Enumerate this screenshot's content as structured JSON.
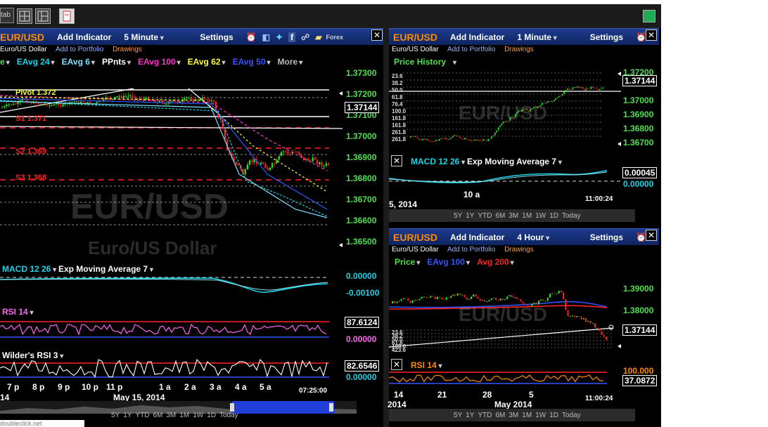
{
  "toolbar": {
    "tab_label": "tab"
  },
  "left": {
    "symbol": "EUR/USD",
    "add_indicator": "Add Indicator",
    "interval": "5 Minute",
    "settings": "Settings",
    "forex_label": "Forex",
    "name": "Euro/US Dollar",
    "add_portfolio": "Add to Portfolio",
    "drawings": "Drawings",
    "indicators": [
      {
        "label": "e",
        "color": "#4fe04f"
      },
      {
        "label": "EAvg 24",
        "color": "#19d4e8"
      },
      {
        "label": "EAvg 6",
        "color": "#7fe0ff"
      },
      {
        "label": "PPnts",
        "color": "#ffffff"
      },
      {
        "label": "EAvg 100",
        "color": "#ff33cc"
      },
      {
        "label": "EAvg 62",
        "color": "#ffff33"
      },
      {
        "label": "EAvg 50",
        "color": "#3355ff"
      },
      {
        "label": "More",
        "color": "#bbbbbb"
      }
    ],
    "pivots": [
      {
        "label": "Pivot 1.372",
        "color": "#ffff33"
      },
      {
        "label": "S1 1.371",
        "color": "#ff2222"
      },
      {
        "label": "S2 1.369",
        "color": "#ff2222"
      },
      {
        "label": "S3 1.368",
        "color": "#ff2222"
      }
    ],
    "price_axis": [
      "1.37300",
      "1.37200",
      "1.37100",
      "1.37000",
      "1.36900",
      "1.36800",
      "1.36700",
      "1.36600",
      "1.36500"
    ],
    "current_price": "1.37144",
    "watermark_symbol": "EUR/USD",
    "watermark_name": "Euro/US Dollar",
    "macd_label": "MACD 12 26",
    "macd_ema_label": "Exp Moving Average 7",
    "macd_axis": [
      "0.00000",
      "-0.00100"
    ],
    "rsi_label": "RSI 14",
    "rsi_value": "87.6124",
    "rsi_axis": "0.00000",
    "wilder_label": "Wilder's RSI 3",
    "wilder_value": "82.6546",
    "wilder_axis": "0.00000",
    "time_labels": [
      "7 p",
      "8 p",
      "9 p",
      "10 p",
      "11 p",
      "1 a",
      "2 a",
      "3 a",
      "4 a",
      "5 a"
    ],
    "date_label": "May 15, 2014",
    "date_prefix": "14",
    "clock": "07:25:00",
    "ranges": [
      "5Y",
      "1Y",
      "YTD",
      "6M",
      "3M",
      "1M",
      "1W",
      "1D",
      "Today"
    ]
  },
  "right_top": {
    "symbol": "EUR/USD",
    "add_indicator": "Add Indicator",
    "interval": "1 Minute",
    "settings": "Settings",
    "name": "Euro/US Dollar",
    "add_portfolio": "Add to Portfolio",
    "drawings": "Drawings",
    "price_history": "Price History",
    "fib_labels": [
      "23.6",
      "38.2",
      "50.0",
      "61.8",
      "76.4",
      "100.0",
      "161.8",
      "161.8",
      "261.8",
      "261.8"
    ],
    "price_axis": [
      "1.37200",
      "1.37000",
      "1.36900",
      "1.36800",
      "1.36700"
    ],
    "current_price": "1.37144",
    "watermark": "EUR/USD",
    "macd_label": "MACD 12 26",
    "macd_ema_label": "Exp Moving Average 7",
    "macd_value": "0.00045",
    "macd_axis": "0.00000",
    "time_label": "10 a",
    "date_label": "5, 2014",
    "clock": "11:00:24",
    "ranges": [
      "5Y",
      "1Y",
      "YTD",
      "6M",
      "3M",
      "1M",
      "1W",
      "1D",
      "Today"
    ]
  },
  "right_bottom": {
    "symbol": "EUR/USD",
    "add_indicator": "Add Indicator",
    "interval": "4 Hour",
    "settings": "Settings",
    "name": "Euro/US Dollar",
    "add_portfolio": "Add to Portfolio",
    "drawings": "Drawings",
    "indicators": [
      {
        "label": "Price",
        "color": "#4fe04f"
      },
      {
        "label": "EAvg 100",
        "color": "#3355ff"
      },
      {
        "label": "Avg 200",
        "color": "#ff2222"
      }
    ],
    "fib_labels": [
      "23.6",
      "38.2",
      "50.0",
      "61.8",
      "100.0",
      "423.6"
    ],
    "price_axis": [
      "1.39000",
      "1.38000",
      "1.37000"
    ],
    "current_price": "1.37144",
    "watermark": "EUR/USD",
    "rsi_label": "RSI 14",
    "rsi_axis": "100.000",
    "rsi_value": "37.0872",
    "time_labels": [
      "14",
      "21",
      "28",
      "5"
    ],
    "date_label": "May 2014",
    "year_label": "2014",
    "clock": "11:00:24",
    "ranges": [
      "5Y",
      "1Y",
      "YTD",
      "6M",
      "3M",
      "1M",
      "1W",
      "1D",
      "Today"
    ]
  },
  "status_url": "doubleclick.net"
}
